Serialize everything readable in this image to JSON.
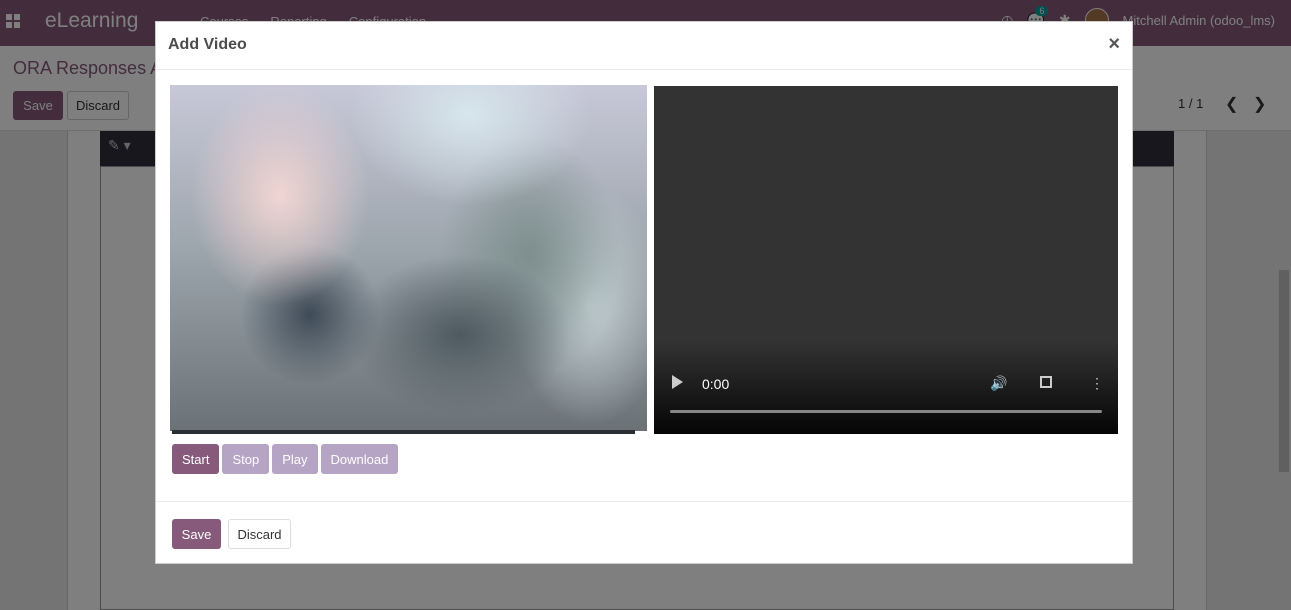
{
  "navbar": {
    "app_name": "eLearning",
    "menu": [
      "Courses",
      "Reporting",
      "Configuration"
    ],
    "messages_count": "6",
    "user_name": "Mitchell Admin (odoo_lms)"
  },
  "control_panel": {
    "breadcrumb": "ORA Responses A",
    "save_label": "Save",
    "discard_label": "Discard",
    "pager": "1 / 1"
  },
  "modal": {
    "title": "Add Video",
    "close_symbol": "×",
    "player": {
      "time": "0:00"
    },
    "recorder_buttons": [
      {
        "label": "Start",
        "state": "enabled"
      },
      {
        "label": "Stop",
        "state": "disabled"
      },
      {
        "label": "Play",
        "state": "disabled"
      },
      {
        "label": "Download",
        "state": "disabled"
      }
    ],
    "footer": {
      "save_label": "Save",
      "discard_label": "Discard"
    }
  },
  "colors": {
    "brand": "#875a7b",
    "disabled_button": "#b5a4c4",
    "badge": "#00a09d"
  }
}
